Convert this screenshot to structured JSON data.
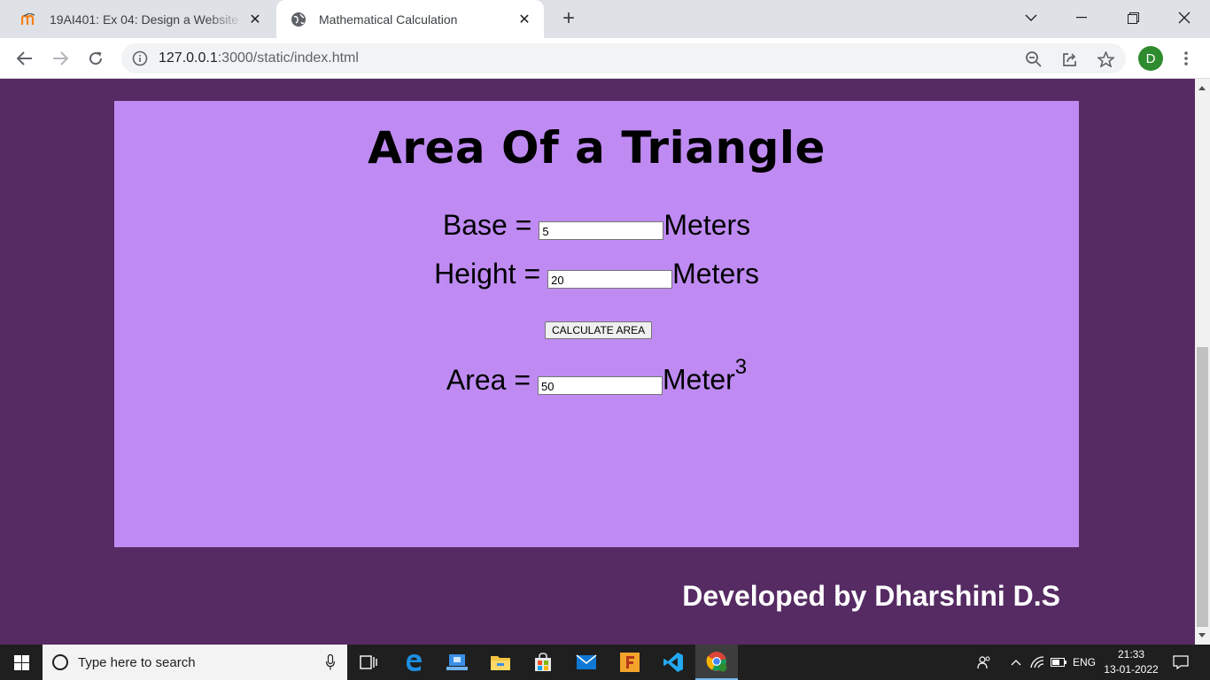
{
  "browser": {
    "tabs": [
      {
        "title": "19AI401: Ex 04: Design a Website",
        "favicon": "moodle-icon",
        "active": false
      },
      {
        "title": "Mathematical Calculation",
        "favicon": "globe-icon",
        "active": true
      }
    ],
    "url_host": "127.0.0.1",
    "url_path": ":3000/static/index.html",
    "profile_initial": "D",
    "profile_color": "#2e8b2e"
  },
  "page": {
    "heading": "Area Of a Triangle",
    "base_label": "Base =",
    "base_value": "5",
    "base_unit": "Meters",
    "height_label": "Height =",
    "height_value": "20",
    "height_unit": "Meters",
    "button_label": "CALCULATE AREA",
    "area_label": "Area =",
    "area_value": "50",
    "area_unit": "Meter",
    "area_unit_exponent": "3",
    "credit": "Developed by Dharshini D.S",
    "colors": {
      "background": "#562b63",
      "panel": "#bf8bf3",
      "credit_text": "#ffffff"
    }
  },
  "taskbar": {
    "search_placeholder": "Type here to search",
    "apps": [
      "task-view-icon",
      "edge-icon",
      "app-icon",
      "file-explorer-icon",
      "store-icon",
      "mail-icon",
      "fusion-icon",
      "vscode-icon",
      "chrome-icon"
    ],
    "language": "ENG",
    "time": "21:33",
    "date": "13-01-2022"
  }
}
